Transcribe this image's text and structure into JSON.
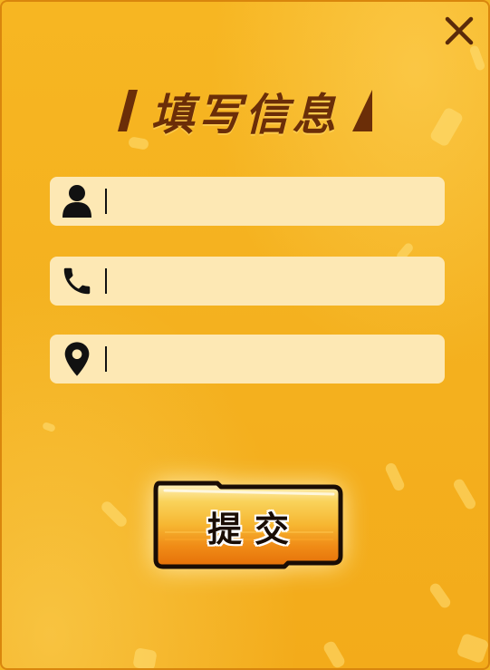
{
  "dialog": {
    "title": "填写信息",
    "close_icon": "close-icon"
  },
  "form": {
    "fields": [
      {
        "icon": "user-icon",
        "value": "",
        "placeholder": ""
      },
      {
        "icon": "phone-icon",
        "value": "",
        "placeholder": ""
      },
      {
        "icon": "location-pin-icon",
        "value": "",
        "placeholder": ""
      }
    ],
    "submit_label": "提交"
  },
  "colors": {
    "background": "#f4b11f",
    "title": "#6b2e08",
    "field_bg": "#fde8b4",
    "button_top": "#f7c842",
    "button_bottom": "#e8740a"
  }
}
